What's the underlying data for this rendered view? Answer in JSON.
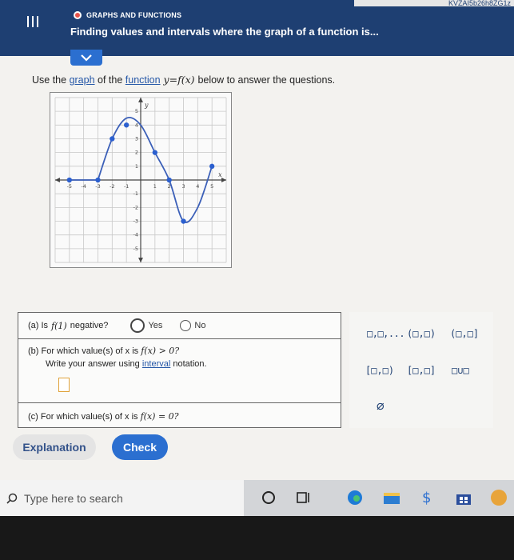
{
  "header": {
    "top_strip_text": "KVZAI5b26h8ZG1z",
    "topic": "GRAPHS AND FUNCTIONS",
    "title": "Finding values and intervals where the graph of a function is..."
  },
  "prompt": {
    "pre": "Use the ",
    "link1": "graph",
    "mid": " of the ",
    "link2": "function",
    "math": " y=f(x) ",
    "post": "below to answer the questions."
  },
  "graph": {
    "x_axis_label": "x",
    "y_axis_label": "y",
    "x_tick_labels": [
      "-5",
      "-4",
      "-3",
      "-2",
      "-1",
      "1",
      "2",
      "3",
      "4",
      "5"
    ],
    "y_tick_labels": [
      "5",
      "4",
      "3",
      "2",
      "1",
      "-1",
      "-2",
      "-3",
      "-4",
      "-5"
    ],
    "xlim": [
      -6,
      6
    ],
    "ylim": [
      -6,
      6
    ],
    "curve_points": [
      [
        -3,
        0
      ],
      [
        -2,
        3
      ],
      [
        -1,
        4.5
      ],
      [
        0,
        4
      ],
      [
        1,
        2
      ],
      [
        2,
        0
      ],
      [
        3,
        -3
      ],
      [
        4,
        -2
      ],
      [
        5,
        1
      ]
    ],
    "marked_points": [
      [
        -5,
        0
      ],
      [
        -3,
        0
      ],
      [
        -2,
        3
      ],
      [
        -1,
        4
      ],
      [
        1,
        2
      ],
      [
        2,
        0
      ],
      [
        3,
        -3
      ],
      [
        5,
        1
      ]
    ],
    "colors": {
      "curve": "#3b5fb8",
      "point": "#2b5fcf",
      "grid": "#c8c8c8",
      "axis": "#444444"
    }
  },
  "questions": {
    "a": {
      "label": "(a) Is",
      "math": "f(1)",
      "tail": "negative?",
      "yes": "Yes",
      "no": "No"
    },
    "b": {
      "label": "(b) For which value(s) of x is",
      "math": "f(x) > 0?",
      "instr_pre": "Write your answer using ",
      "instr_link": "interval",
      "instr_post": " notation."
    },
    "c": {
      "label": "(c) For which value(s) of x is",
      "math": "f(x) = 0?"
    }
  },
  "palette": {
    "row1": [
      "□,□,...",
      "(□,□)",
      "(□,□]"
    ],
    "row2": [
      "[□,□)",
      "[□,□]",
      "□∪□"
    ],
    "empty_set": "∅"
  },
  "buttons": {
    "explanation": "Explanation",
    "check": "Check"
  },
  "taskbar": {
    "search_placeholder": "Type here to search",
    "icons": [
      "cortana-icon",
      "task-view-icon",
      "edge-icon",
      "file-explorer-icon",
      "money-icon",
      "store-icon",
      "app-icon"
    ]
  }
}
